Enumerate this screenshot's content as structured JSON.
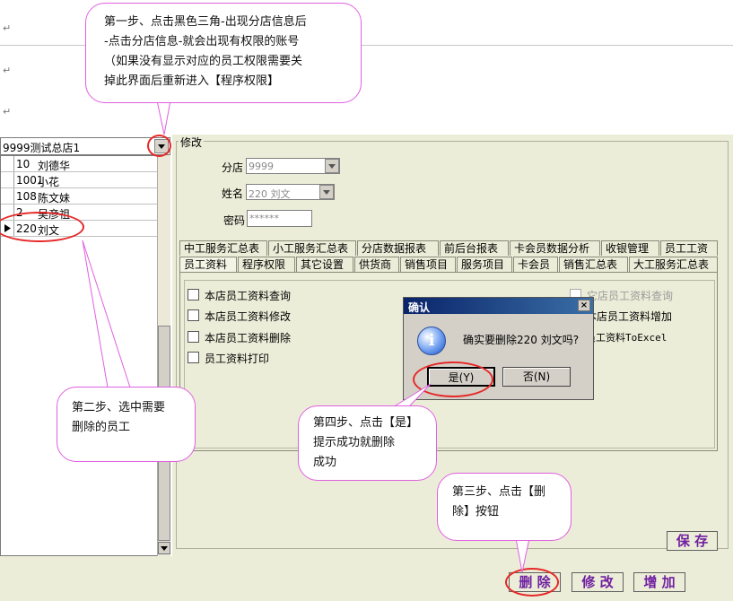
{
  "callouts": {
    "step1": [
      "第一步、点击黑色三角-出现分店信息后",
      "-点击分店信息-就会出现有权限的账号",
      "（如果没有显示对应的员工权限需要关",
      "掉此界面后重新进入【程序权限】"
    ],
    "step2": [
      "第二步、选中需要",
      "删除的员工"
    ],
    "step3": [
      "第三步、点击【删",
      "除】按钮"
    ],
    "step4": [
      "第四步、点击【是】",
      "提示成功就删除",
      "成功"
    ]
  },
  "store_combo": "9999测试总店1",
  "staff_list": [
    {
      "id": "10",
      "name": "刘德华"
    },
    {
      "id": "1001",
      "name": "小花"
    },
    {
      "id": "108",
      "name": "陈文妹"
    },
    {
      "id": "2",
      "name": "吴彦祖"
    },
    {
      "id": "220",
      "name": "刘文"
    }
  ],
  "form": {
    "group_label": "修改",
    "store_label": "分店",
    "store_value": "9999",
    "name_label": "姓名",
    "name_value": "220 刘文",
    "password_label": "密码",
    "password_value": "******"
  },
  "tabs_row1": [
    "中工服务汇总表",
    "小工服务汇总表",
    "分店数据报表",
    "前后台报表",
    "卡会员数据分析",
    "收银管理",
    "员工工资"
  ],
  "tabs_row2": [
    "员工资料",
    "程序权限",
    "其它设置",
    "供货商",
    "销售项目",
    "服务项目",
    "卡会员",
    "销售汇总表",
    "大工服务汇总表"
  ],
  "permissions_left": [
    "本店员工资料查询",
    "本店员工资料修改",
    "本店员工资料删除",
    "员工资料打印"
  ],
  "permissions_right": [
    "它店员工资料查询",
    "本店员工资料增加",
    "员工资料ToExcel"
  ],
  "dialog": {
    "title": "确认",
    "close": "×",
    "message": "确实要删除220 刘文吗?",
    "yes": "是(Y)",
    "no": "否(N)"
  },
  "buttons": {
    "save": "保 存",
    "delete": "删 除",
    "edit": "修 改",
    "add": "增 加"
  },
  "colors": {
    "callout_border": "#e060e0",
    "highlight_ring": "#e62828",
    "panel_bg": "#ecedd8",
    "dialog_title": "#0a246a"
  }
}
